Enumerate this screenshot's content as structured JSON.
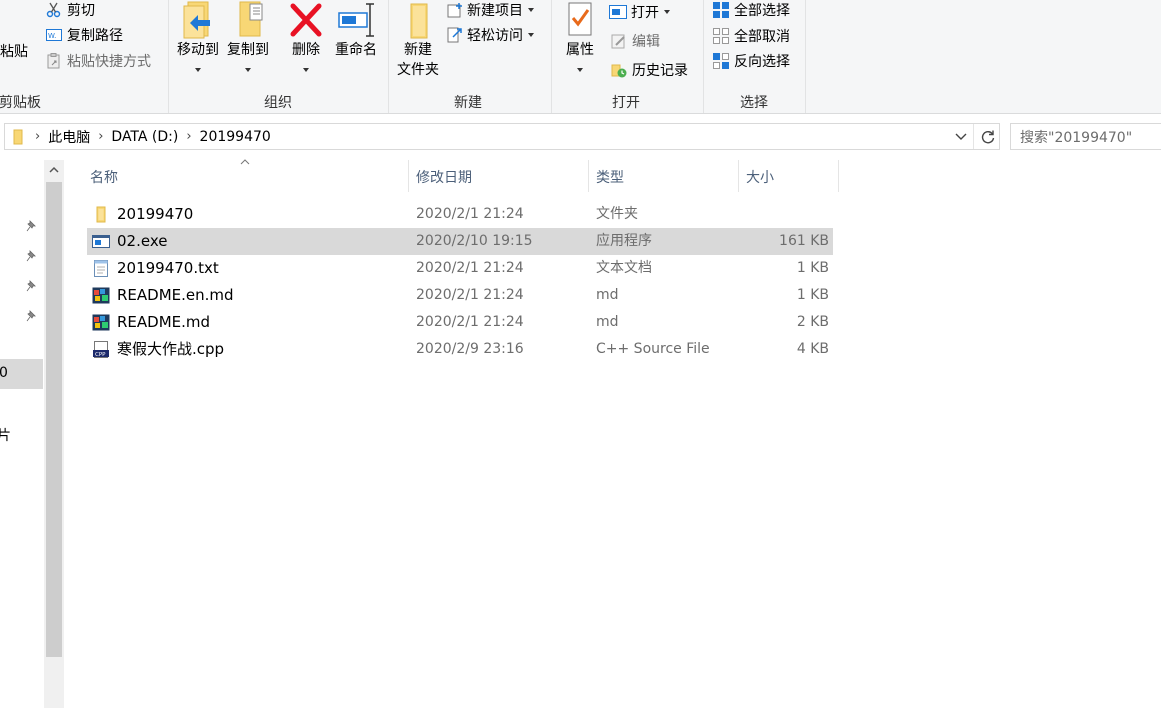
{
  "ribbon": {
    "clipboard": {
      "paste_label": "粘贴",
      "cut_label": "剪切",
      "copy_path_label": "复制路径",
      "paste_shortcut_label": "粘贴快捷方式",
      "group_label": "剪贴板"
    },
    "organize": {
      "move_to_label": "移动到",
      "copy_to_label": "复制到",
      "delete_label": "删除",
      "rename_label": "重命名",
      "group_label": "组织"
    },
    "new": {
      "new_folder_line1": "新建",
      "new_folder_line2": "文件夹",
      "new_item_label": "新建项目",
      "easy_access_label": "轻松访问",
      "group_label": "新建"
    },
    "open": {
      "properties_label": "属性",
      "open_label": "打开",
      "edit_label": "编辑",
      "history_label": "历史记录",
      "group_label": "打开"
    },
    "select": {
      "select_all_label": "全部选择",
      "select_none_label": "全部取消",
      "invert_label": "反向选择",
      "group_label": "选择"
    }
  },
  "address": {
    "crumbs": [
      "此电脑",
      "DATA (D:)",
      "20199470"
    ]
  },
  "search": {
    "placeholder": "搜索\"20199470\""
  },
  "nav": {
    "partial_item_1": "0",
    "partial_item_2": "片"
  },
  "columns": {
    "name": "名称",
    "date": "修改日期",
    "type": "类型",
    "size": "大小"
  },
  "files": [
    {
      "name": "20199470",
      "date": "2020/2/1 21:24",
      "type": "文件夹",
      "size": "",
      "icon": "folder-icon",
      "selected": false
    },
    {
      "name": "02.exe",
      "date": "2020/2/10 19:15",
      "type": "应用程序",
      "size": "161 KB",
      "icon": "exe-icon",
      "selected": true
    },
    {
      "name": "20199470.txt",
      "date": "2020/2/1 21:24",
      "type": "文本文档",
      "size": "1 KB",
      "icon": "text-file-icon",
      "selected": false
    },
    {
      "name": "README.en.md",
      "date": "2020/2/1 21:24",
      "type": "md",
      "size": "1 KB",
      "icon": "md-file-icon",
      "selected": false
    },
    {
      "name": "README.md",
      "date": "2020/2/1 21:24",
      "type": "md",
      "size": "2 KB",
      "icon": "md-file-icon",
      "selected": false
    },
    {
      "name": "寒假大作战.cpp",
      "date": "2020/2/9 23:16",
      "type": "C++ Source File",
      "size": "4 KB",
      "icon": "cpp-file-icon",
      "selected": false
    }
  ],
  "colors": {
    "selection": "#d9d9d9",
    "accent_blue": "#1e78d6",
    "folder_yellow": "#f8d775",
    "delete_red": "#e81123"
  }
}
